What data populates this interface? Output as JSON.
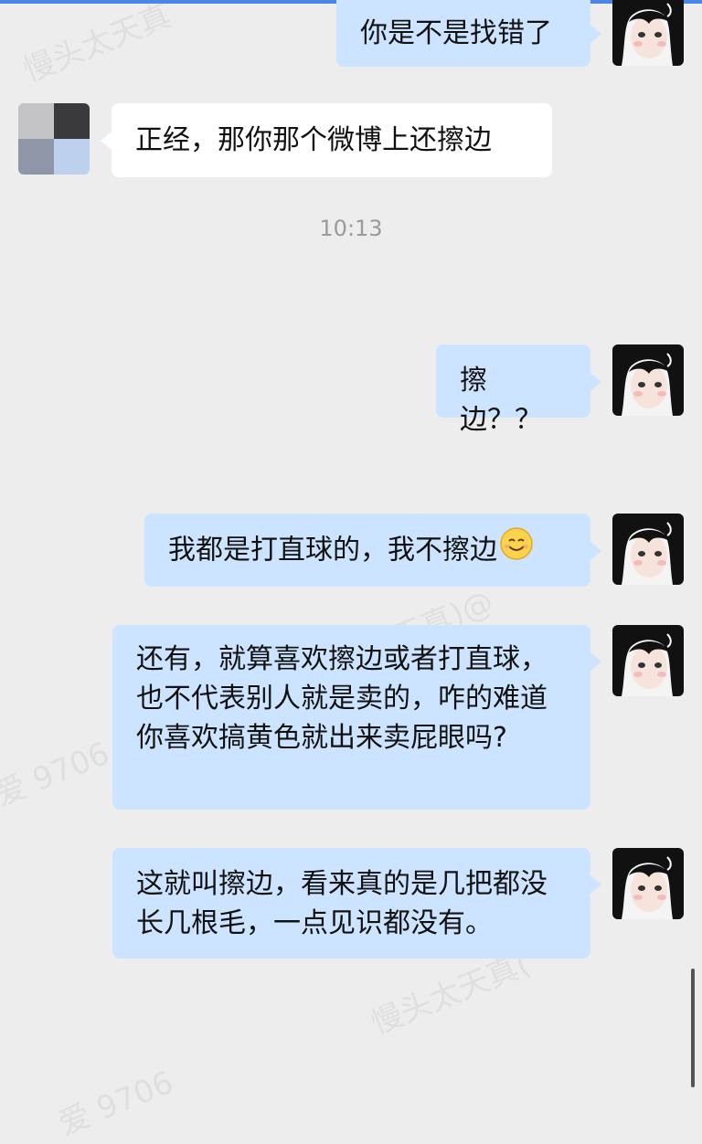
{
  "messages": [
    {
      "side": "out",
      "text": "你是不是找错了"
    },
    {
      "side": "in",
      "text": "正经，那你那个微博上还擦边"
    },
    {
      "side": "out",
      "text": "擦边？？"
    },
    {
      "side": "out",
      "text": "我都是打直球的，我不擦边",
      "emoji": "smile-emoji"
    },
    {
      "side": "out",
      "text": "还有，就算喜欢擦边或者打直球，也不代表别人就是卖的，咋的难道你喜欢搞黄色就出来卖屁眼吗?"
    },
    {
      "side": "out",
      "text": "这就叫擦边，看来真的是几把都没长几根毛，一点见识都没有。"
    }
  ],
  "timestamp": "10:13",
  "watermarks": [
    "慢头太天真",
    "爱 9706",
    "(慢天真)@",
    "慢头太天真(",
    "爱 9706"
  ],
  "colors": {
    "background": "#ededed",
    "outgoing_bubble": "#cce4ff",
    "incoming_bubble": "#ffffff",
    "text": "#111111",
    "timestamp": "#9a9a9a",
    "accent_bar": "#4a86e8"
  },
  "icons": {
    "self_avatar": "anime-girl-avatar",
    "contact_avatar": "pixelated-avatar",
    "emoji": "smiling-face-emoji"
  }
}
